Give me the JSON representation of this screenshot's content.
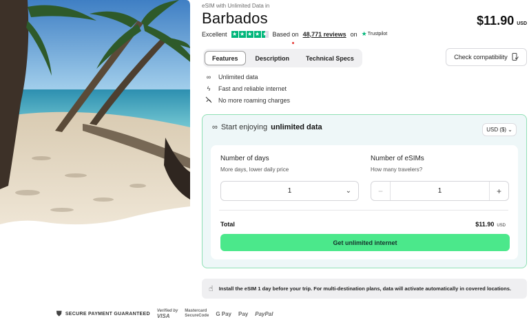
{
  "product": {
    "eyebrow": "eSIM with Unlimited Data in",
    "title": "Barbados",
    "price": "$11.90",
    "currency": "USD"
  },
  "rating": {
    "label": "Excellent",
    "based_on": "Based on",
    "review_count": "48,771 reviews",
    "on": "on",
    "provider": "Trustpilot",
    "stars": 4.5
  },
  "tabs": [
    {
      "label": "Features",
      "active": true
    },
    {
      "label": "Description",
      "active": false
    },
    {
      "label": "Technical Specs",
      "active": false
    }
  ],
  "compat_button": "Check compatibility",
  "features": [
    {
      "icon": "infinity-icon",
      "label": "Unlimited data"
    },
    {
      "icon": "lightning-icon",
      "label": "Fast and reliable internet"
    },
    {
      "icon": "no-roaming-icon",
      "label": "No more roaming charges"
    }
  ],
  "plan": {
    "heading_prefix": "Start enjoying",
    "heading_bold": "unlimited data",
    "currency_select": "USD ($)",
    "days": {
      "label": "Number of days",
      "hint": "More days, lower daily price",
      "value": "1"
    },
    "esims": {
      "label": "Number of eSIMs",
      "hint": "How many travelers?",
      "value": "1"
    },
    "total_label": "Total",
    "total_amount": "$11.90",
    "total_currency": "USD",
    "cta": "Get unlimited internet"
  },
  "notice": "Install the eSIM 1 day before your trip. For multi-destination plans, data will activate automatically in covered locations.",
  "payments": {
    "secure": "SECURE PAYMENT GUARANTEED",
    "verified_by": "Verified by",
    "visa": "VISA",
    "mastercard": "Mastercard",
    "securecode": "SecureCode",
    "gpay": "G Pay",
    "applepay": "Pay",
    "paypal": "PayPal"
  },
  "colors": {
    "accent_green": "#4be88b",
    "trustpilot_green": "#00b67a",
    "plan_bg": "#eef7f8",
    "plan_border": "#8fe0b4"
  }
}
